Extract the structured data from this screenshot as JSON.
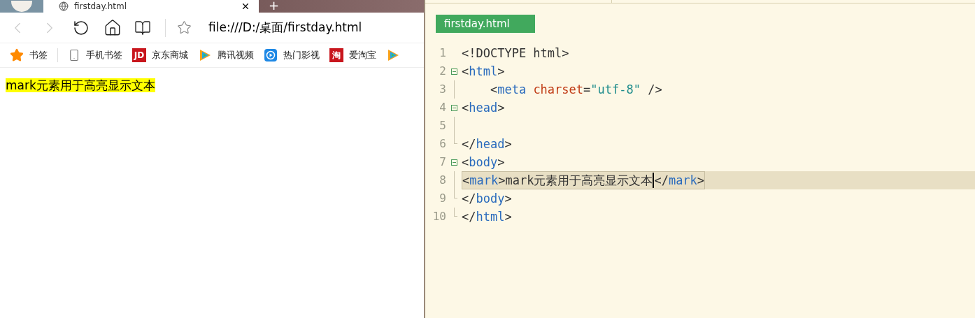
{
  "browser": {
    "tab": {
      "title": "firstday.html"
    },
    "new_tab": "+",
    "nav": {
      "back_disabled": true,
      "forward_disabled": true
    },
    "address": "file:///D:/桌面/firstday.html",
    "bookmarks": [
      {
        "kind": "star",
        "label": "书签"
      },
      {
        "kind": "phone",
        "label": "手机书签"
      },
      {
        "kind": "badge",
        "badge": "JD",
        "label": "京东商城"
      },
      {
        "kind": "video",
        "label": "腾讯视频"
      },
      {
        "kind": "play",
        "label": "热门影视"
      },
      {
        "kind": "badge",
        "badge": "淘",
        "label": "爱淘宝"
      },
      {
        "kind": "video"
      }
    ],
    "content": {
      "marked_text": "mark元素用于高亮显示文本"
    }
  },
  "editor": {
    "tab": "firstday.html",
    "lines": [
      {
        "number": "1",
        "kind": "plain",
        "current": false,
        "tokens": [
          {
            "text": "<!DOCTYPE html>",
            "kind": "plain"
          }
        ]
      },
      {
        "number": "2",
        "kind": "fold",
        "current": false,
        "tokens": [
          {
            "text": "<",
            "kind": "plain"
          },
          {
            "text": "html",
            "kind": "tag"
          },
          {
            "text": ">",
            "kind": "plain"
          }
        ]
      },
      {
        "number": "3",
        "kind": "inner",
        "current": false,
        "tokens": [
          {
            "text": "    <",
            "kind": "plain"
          },
          {
            "text": "meta",
            "kind": "tag"
          },
          {
            "text": " charset",
            "kind": "attr"
          },
          {
            "text": "=",
            "kind": "plain"
          },
          {
            "text": "\"utf-8\"",
            "kind": "string"
          },
          {
            "text": " />",
            "kind": "plain"
          }
        ]
      },
      {
        "number": "4",
        "kind": "fold",
        "current": false,
        "tokens": [
          {
            "text": "<",
            "kind": "plain"
          },
          {
            "text": "head",
            "kind": "tag"
          },
          {
            "text": ">",
            "kind": "plain"
          }
        ]
      },
      {
        "number": "5",
        "kind": "inner",
        "current": false
      },
      {
        "number": "6",
        "kind": "end",
        "current": false,
        "tokens": [
          {
            "text": "</",
            "kind": "plain"
          },
          {
            "text": "head",
            "kind": "tag"
          },
          {
            "text": ">",
            "kind": "plain"
          }
        ]
      },
      {
        "number": "7",
        "kind": "fold",
        "current": false,
        "tokens": [
          {
            "text": "<",
            "kind": "plain"
          },
          {
            "text": "body",
            "kind": "tag"
          },
          {
            "text": ">",
            "kind": "plain"
          }
        ]
      },
      {
        "number": "8",
        "kind": "inner",
        "current": true,
        "tokens": [
          {
            "text": "<",
            "kind": "plain"
          },
          {
            "text": "mark",
            "kind": "tag"
          },
          {
            "text": ">",
            "kind": "plain"
          },
          {
            "text": "mark元素用于高亮显示文本",
            "kind": "plain",
            "caret_after": true
          },
          {
            "text": "</",
            "kind": "plain"
          },
          {
            "text": "mark",
            "kind": "tag"
          },
          {
            "text": ">",
            "kind": "plain"
          }
        ]
      },
      {
        "number": "9",
        "kind": "end",
        "current": false,
        "tokens": [
          {
            "text": "</",
            "kind": "plain"
          },
          {
            "text": "body",
            "kind": "tag"
          },
          {
            "text": ">",
            "kind": "plain"
          }
        ]
      },
      {
        "number": "10",
        "kind": "end",
        "current": false,
        "tokens": [
          {
            "text": "</",
            "kind": "plain"
          },
          {
            "text": "html",
            "kind": "tag"
          },
          {
            "text": ">",
            "kind": "plain"
          }
        ]
      }
    ]
  }
}
